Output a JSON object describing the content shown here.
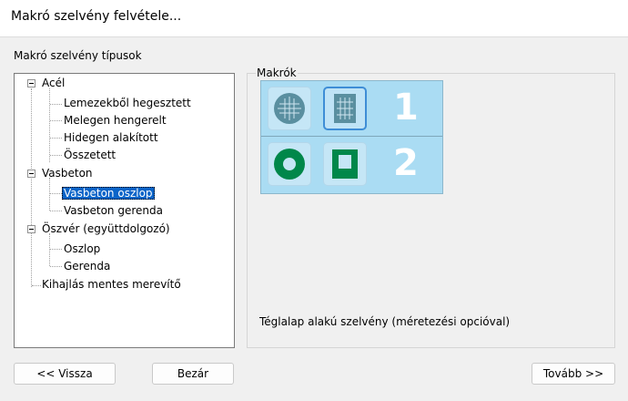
{
  "window": {
    "title": "Makró szelvény felvétele..."
  },
  "tree": {
    "label": "Makró szelvény típusok",
    "nodes": [
      {
        "label": "Acél"
      },
      {
        "label": "Lemezekből hegesztett"
      },
      {
        "label": "Melegen hengerelt"
      },
      {
        "label": "Hidegen alakított"
      },
      {
        "label": "Összetett"
      },
      {
        "label": "Vasbeton"
      },
      {
        "label": "Vasbeton oszlop",
        "selected": true
      },
      {
        "label": "Vasbeton gerenda"
      },
      {
        "label": "Öszvér (együttdolgozó)"
      },
      {
        "label": "Oszlop"
      },
      {
        "label": "Gerenda"
      },
      {
        "label": "Kihajlás mentes merevítő"
      }
    ]
  },
  "macros": {
    "legend": "Makrók",
    "row_numbers": [
      "1",
      "2"
    ],
    "tiles": [
      {
        "icon": "circle-rebar-grid-icon",
        "row": 1,
        "selected": false
      },
      {
        "icon": "rect-rebar-grid-icon",
        "row": 1,
        "selected": true
      },
      {
        "icon": "hollow-circle-icon",
        "row": 2,
        "selected": false
      },
      {
        "icon": "hollow-rectangle-icon",
        "row": 2,
        "selected": false
      }
    ],
    "description": "Téglalap alakú szelvény (méretezési opcióval)"
  },
  "buttons": {
    "back": "<< Vissza",
    "close": "Bezár",
    "next": "Tovább >>"
  },
  "colors": {
    "selection": "#0a64c8",
    "macro_panel": "#aadcf3",
    "icon_teal": "#5a8fa0",
    "icon_green": "#00874a"
  }
}
